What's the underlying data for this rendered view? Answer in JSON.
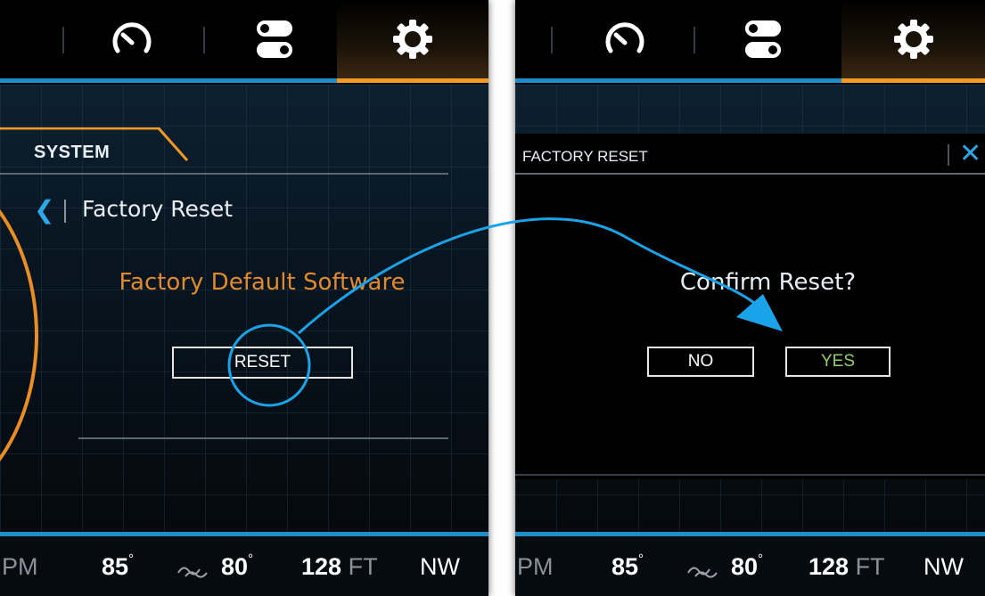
{
  "left_screen": {
    "section_tab": "SYSTEM",
    "back_icon": "chevron-left-icon",
    "breadcrumb": "Factory Reset",
    "heading": "Factory Default Software",
    "reset_button": "RESET"
  },
  "right_screen": {
    "dialog_title": "FACTORY RESET",
    "close_icon": "close-icon",
    "prompt": "Confirm Reset?",
    "no_button": "NO",
    "yes_button": "YES"
  },
  "top_tabs": [
    {
      "icon": "speedometer-icon"
    },
    {
      "icon": "toggles-icon"
    },
    {
      "icon": "gear-icon",
      "active": true
    }
  ],
  "status_bar": {
    "rpm_fragment": "PM",
    "temp1": "85",
    "temp2": "80",
    "depth": "128",
    "depth_unit": "FT",
    "heading": "NW",
    "degree_symbol": "°"
  },
  "colors": {
    "accent_blue": "#1f8dc6",
    "accent_orange": "#f39a24",
    "heading_orange": "#e08a30",
    "yes_green": "#8fd06a",
    "annotation_blue": "#1aa3e8"
  }
}
